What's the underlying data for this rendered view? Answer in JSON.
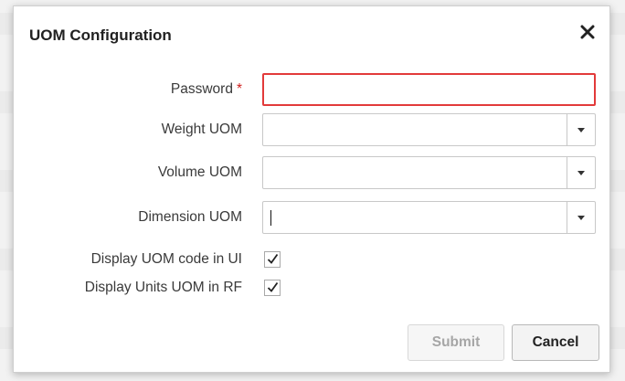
{
  "dialog": {
    "title": "UOM Configuration",
    "close_icon": "close-icon"
  },
  "fields": {
    "password": {
      "label": "Password",
      "required_mark": "*",
      "value": ""
    },
    "weight_uom": {
      "label": "Weight UOM",
      "value": ""
    },
    "volume_uom": {
      "label": "Volume UOM",
      "value": ""
    },
    "dimension_uom": {
      "label": "Dimension UOM",
      "value": ""
    }
  },
  "checkboxes": {
    "display_uom_code_in_ui": {
      "label": "Display UOM code in UI",
      "checked": true
    },
    "display_units_uom_in_rf": {
      "label": "Display Units UOM in RF",
      "checked": true
    }
  },
  "buttons": {
    "submit": "Submit",
    "cancel": "Cancel"
  },
  "colors": {
    "required": "#d0211f",
    "error_border": "#e23a3a",
    "disabled_text": "#a6a6a6"
  }
}
